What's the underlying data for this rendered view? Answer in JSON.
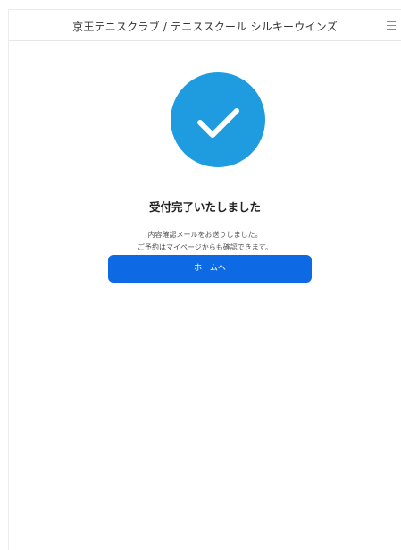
{
  "header": {
    "title": "京王テニスクラブ / テニススクール シルキーウインズ",
    "menu_icon": "hamburger-menu-icon"
  },
  "status": {
    "icon": "check-icon",
    "icon_color": "#1f9ce0",
    "title": "受付完了いたしました",
    "message_line1": "内容確認メールをお送りしました。",
    "message_line2": "ご予約はマイページからも確認できます。"
  },
  "actions": {
    "home_label": "ホームへ",
    "home_color": "#0d6ae4"
  }
}
